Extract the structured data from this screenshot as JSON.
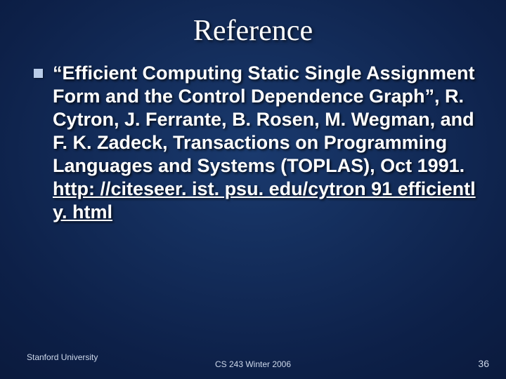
{
  "slide": {
    "title": "Reference",
    "bullet_text_pre": "“Efficient Computing Static Single Assignment Form and the Control Dependence Graph”, R. Cytron, J. Ferrante, B. Rosen, M. Wegman, and F. K. Zadeck, Transactions on Programming Languages and Systems (TOPLAS), Oct 1991. ",
    "bullet_link": "http: //citeseer. ist. psu. edu/cytron 91 efficiently. html"
  },
  "footer": {
    "left": "Stanford University",
    "center": "CS 243 Winter 2006",
    "right": "36"
  }
}
